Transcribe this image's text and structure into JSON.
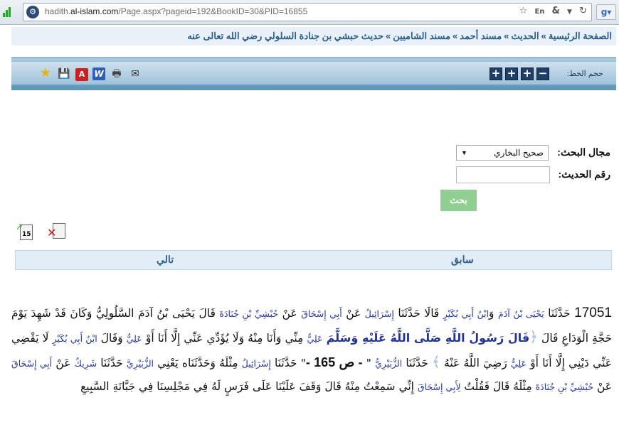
{
  "browser": {
    "url_prefix": "hadith.",
    "url_domain": "al-islam.com",
    "url_path": "/Page.aspx?pageid=192&BookID=30&PID=16855",
    "icons": [
      "signal-icon",
      "site-icon",
      "star-icon",
      "translate-icon",
      "ampersand-icon",
      "dropdown-icon",
      "refresh-icon",
      "google-icon"
    ]
  },
  "breadcrumb": {
    "items": [
      "الصفحة الرئيسية",
      "الحديث",
      "مسند أحمد",
      "مسند الشاميين",
      "حديث حبشي بن جنادة السلولي رضي الله تعالى عنه"
    ],
    "separator": "»"
  },
  "toolbar": {
    "font_size_label": "حجم الخط:",
    "font_buttons": [
      "+",
      "+",
      "+",
      "+",
      "−"
    ],
    "icons": [
      "star-icon",
      "save-icon",
      "pdf-icon",
      "word-icon",
      "print-icon",
      "mail-icon"
    ]
  },
  "search": {
    "field_label": "مجال البحث:",
    "field_value": "صحيح البخاري",
    "number_label": "رقم الحديث:",
    "number_value": "",
    "button_label": "بحث"
  },
  "doc_icons": {
    "first_number": "15"
  },
  "nav": {
    "previous": "سابق",
    "next": "تالي"
  },
  "hadith": {
    "number": "17051",
    "t1": " حَدَّثَنَا ",
    "n1": "يَحْيَى بْنُ آدَمَ",
    "t2": " وَ",
    "n2": "ابْنُ أَبِي بُكَيْرٍ",
    "t3": " قَالَا حَدَّثَنَا ",
    "n3": "إِسْرَائِيلُ",
    "t4": " عَنْ ",
    "n4": "أَبِي إِسْحَاقَ",
    "t5": " عَنْ ",
    "n5": "حُبْشِيِّ بْنِ جُنَادَةَ",
    "t6": " قَالَ يَحْيَى بْنُ آدَمَ السَّلُولِيُّ وَكَانَ قَدْ شَهِدَ يَوْمَ حَجَّةِ الْوَدَاعِ قَالَ ",
    "orn_open": "﴿",
    "prophet": "قَالَ رَسُولُ اللَّهِ صَلَّى اللَّهُ عَلَيْهِ وَسَلَّمَ",
    "t7": " ",
    "n6": "عَلِيٌّ",
    "t8": " مِنِّي وَأَنَا مِنْهُ وَلَا يُؤَدِّي عَنِّي إِلَّا أَنَا أَوْ ",
    "n7": "عَلِيٌّ",
    "t9": " وَقَالَ ",
    "n8": "ابْنُ أَبِي بُكَيْرٍ",
    "t10": " لَا يَقْضِي عَنِّي دَيْنِي إِلَّا أَنَا أَوْ ",
    "n9": "عَلِيٌّ",
    "t11": " رَضِيَ اللَّهُ عَنْهُ ",
    "orn_close": "﴾",
    "t12": " حَدَّثَنَا ",
    "n10": "الزُّبَيْرِيُّ",
    "t13": " \" ",
    "page_marker": "- ص 165 -",
    "t14": "\" حَدَّثَنَا ",
    "n11": "إِسْرَائِيلُ",
    "t15": " مِثْلَهُ وَحَدَّثَنَاه يَعْنِي ",
    "n12": "الزُّبَيْرِيَّ",
    "t16": " حَدَّثَنَا ",
    "n13": "شَرِيكٌ",
    "t17": " عَنْ ",
    "n14": "أَبِي إِسْحَاقَ",
    "t18": " عَنْ ",
    "n15": "حُبْشِيِّ بْنِ جُنَادَةَ",
    "t19": " مِثْلَهُ قَالَ فَقُلْتُ ",
    "n16": "لِأَبِي إِسْحَاقَ",
    "t20": " إِنِّي سَمِعْتُ مِنْهُ قَالَ وَقَفَ عَلَيْنَا عَلَى فَرَسٍ لَهُ فِي مَجْلِسِنَا فِي جَبَّانَةِ السَّبِيعِ"
  }
}
